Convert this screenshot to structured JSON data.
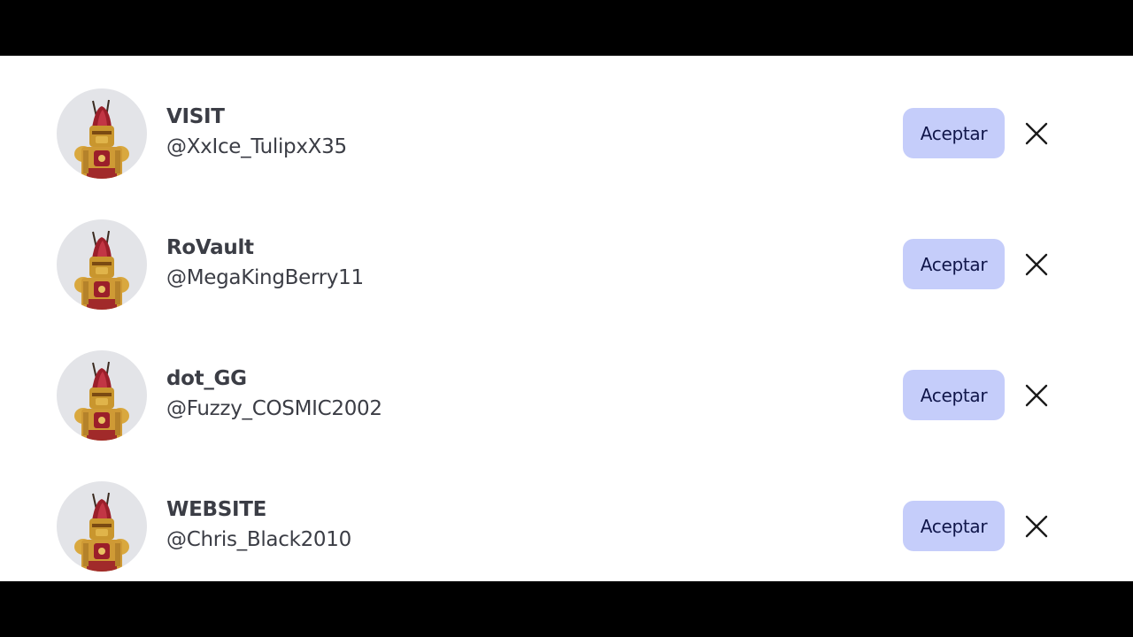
{
  "requests": [
    {
      "name": "VISIT",
      "handle": "@XxIce_TulipxX35",
      "accept_label": "Aceptar"
    },
    {
      "name": "RoVault",
      "handle": "@MegaKingBerry11",
      "accept_label": "Aceptar"
    },
    {
      "name": "dot_GG",
      "handle": "@Fuzzy_COSMIC2002",
      "accept_label": "Aceptar"
    },
    {
      "name": "WEBSITE",
      "handle": "@Chris_Black2010",
      "accept_label": "Aceptar"
    }
  ],
  "icons": {
    "avatar": "knight-avatar-icon",
    "dismiss": "close-icon"
  },
  "colors": {
    "accept_bg": "#c5cdfa",
    "accept_text": "#10164a",
    "text": "#3b3d45",
    "avatar_bg": "#e3e4e8"
  }
}
